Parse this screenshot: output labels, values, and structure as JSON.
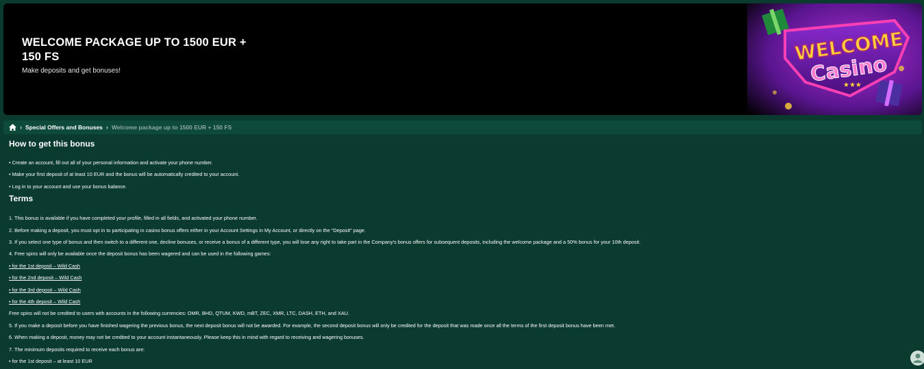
{
  "banner": {
    "title": "WELCOME PACKAGE UP TO 1500 EUR + 150 FS",
    "subtitle": "Make deposits and get bonuses!",
    "art_word1": "WELCOME",
    "art_word2": "Casino"
  },
  "breadcrumb": {
    "home_icon": "home-icon",
    "items": [
      "Special Offers and Bonuses",
      "Welcome package up to 1500 EUR + 150 FS"
    ]
  },
  "how_to": {
    "heading": "How to get this bonus",
    "items": [
      "• Create an account, fill out all of your personal information and activate your phone number.",
      "• Make your first deposit of at least 10 EUR and the bonus will be automatically credited to your account.",
      "• Log in to your account and use your bonus balance."
    ]
  },
  "terms": {
    "heading": "Terms",
    "t1": "1. This bonus is available if you have completed your profile, filled in all fields, and activated your phone number.",
    "t2": "2. Before making a deposit, you must opt in to participating in casino bonus offers either in your Account Settings in My Account, or directly on the \"Deposit\" page.",
    "t3": "3. If you select one type of bonus and then switch to a different one, decline bonuses, or receive a bonus of a different type, you will lose any right to take part in the Company's bonus offers for subsequent deposits, including the welcome package and a 50% bonus for your 10th deposit.",
    "t4": "4. Free spins will only be available once the deposit bonus has been wagered and can be used in the following games:",
    "t4_links": [
      "• for the 1st deposit – Wild Cash",
      "• for the 2nd deposit – Wild Cash",
      "• for the 3rd deposit – Wild Cash",
      "• for the 4th deposit – Wild Cash"
    ],
    "currency_note": "Free spins will not be credited to users with accounts in the following currencies: OMR, BHD, QTUM, KWD, mBT, ZEC, XMR, LTC, DASH, ETH, and XAU.",
    "t5": "5. If you make a deposit before you have finished wagering the previous bonus, the next deposit bonus will not be awarded. For example, the second deposit bonus will only be credited for the deposit that was made once all the terms of the first deposit bonus have been met.",
    "t6": "6. When making a deposit, money may not be credited to your account instantaneously. Please keep this in mind with regard to receiving and wagering bonuses.",
    "t7": "7. The minimum deposits required to receive each bonus are:",
    "t7_items": [
      "• for the 1st deposit – at least 10 EUR"
    ]
  },
  "colors": {
    "page_bg": "#0b3a2f",
    "breadcrumb_bg": "#0e4a3a",
    "banner_bg": "#000000",
    "art_purple": "#7a1fb0",
    "art_pink": "#ff3fb4",
    "art_gold": "#ffd23a"
  },
  "chat_icon": "chat-icon"
}
